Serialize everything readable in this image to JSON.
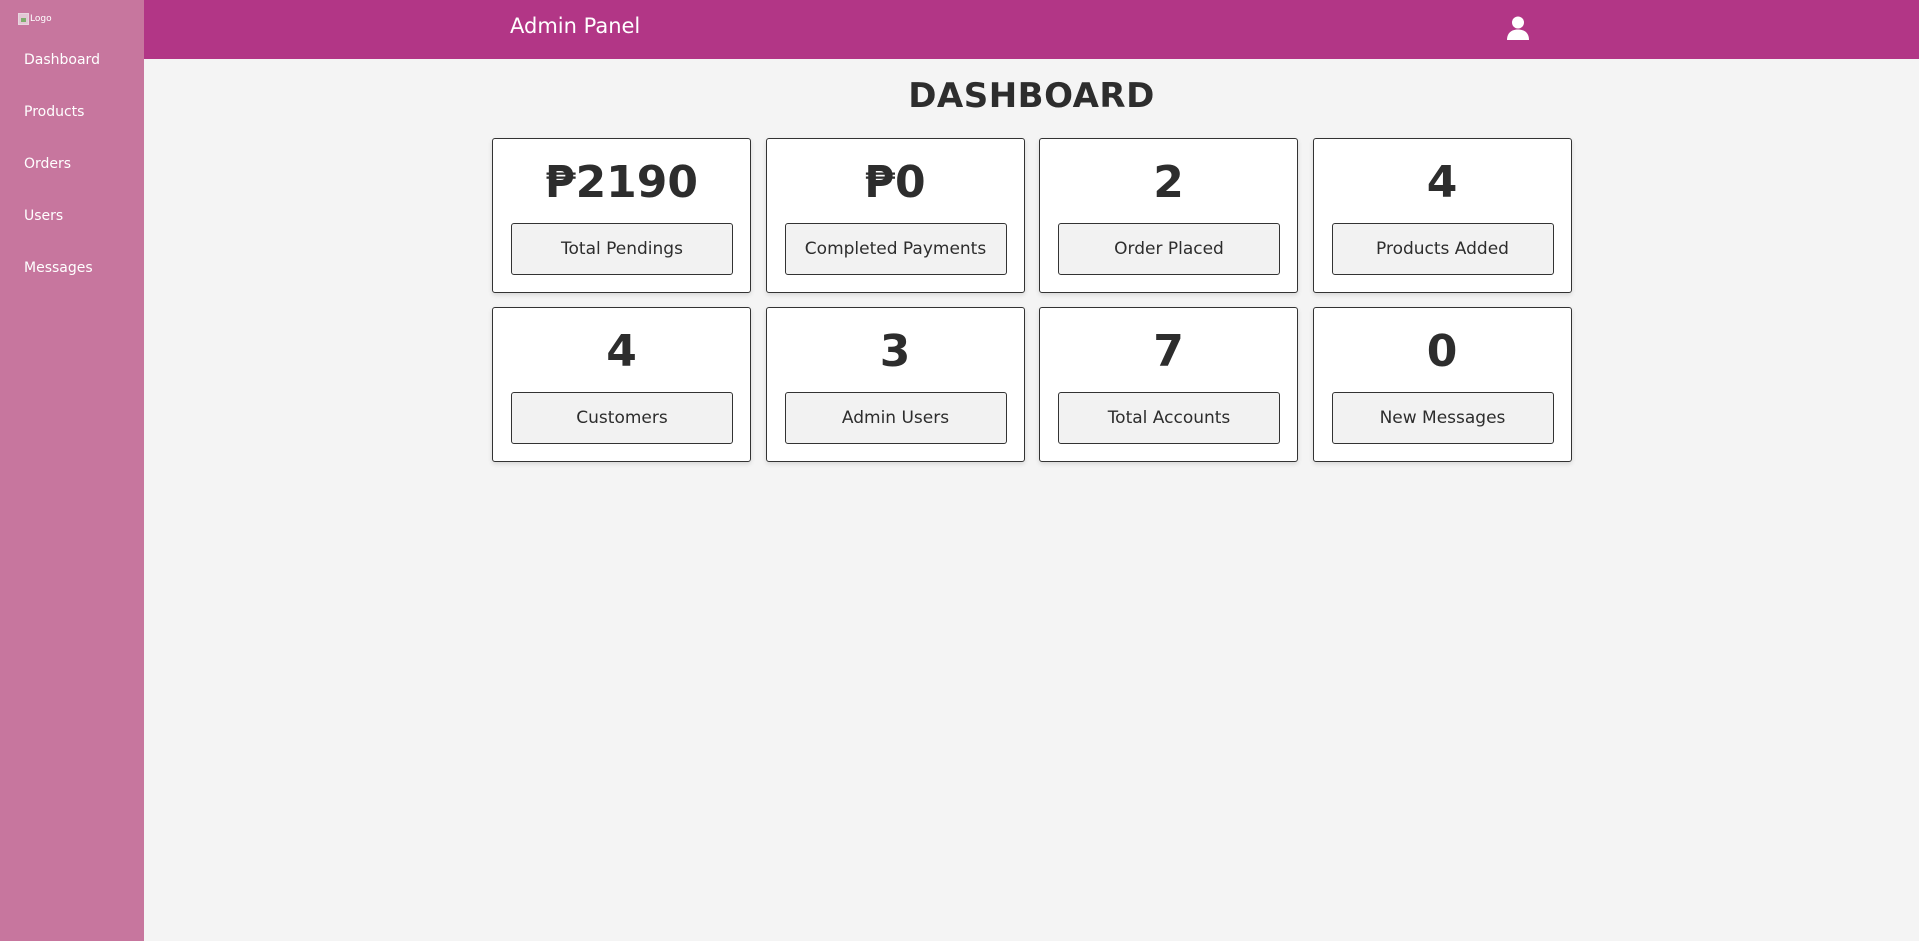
{
  "sidebar": {
    "logo_alt": "Logo",
    "items": [
      {
        "label": "Dashboard"
      },
      {
        "label": "Products"
      },
      {
        "label": "Orders"
      },
      {
        "label": "Users"
      },
      {
        "label": "Messages"
      }
    ]
  },
  "header": {
    "title": "Admin Panel",
    "user_icon": "user-icon"
  },
  "main": {
    "title": "DASHBOARD",
    "cards": [
      {
        "value": "₱2190",
        "label": "Total Pendings"
      },
      {
        "value": "₱0",
        "label": "Completed Payments"
      },
      {
        "value": "2",
        "label": "Order Placed"
      },
      {
        "value": "4",
        "label": "Products Added"
      },
      {
        "value": "4",
        "label": "Customers"
      },
      {
        "value": "3",
        "label": "Admin Users"
      },
      {
        "value": "7",
        "label": "Total Accounts"
      },
      {
        "value": "0",
        "label": "New Messages"
      }
    ]
  },
  "colors": {
    "sidebar_bg": "#c7769e",
    "header_bg": "#b23686",
    "page_bg": "#f4f4f4",
    "text": "#2d2d2d"
  }
}
